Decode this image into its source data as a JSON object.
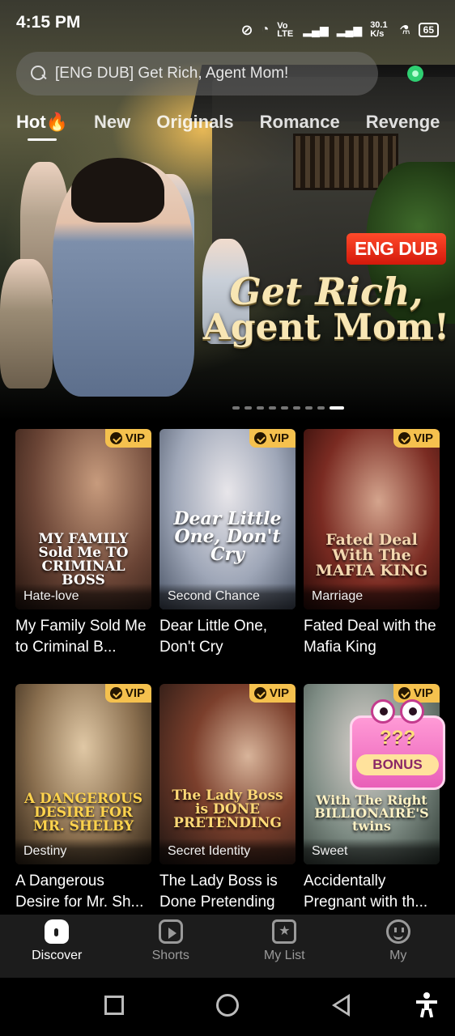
{
  "status_bar": {
    "time": "4:15 PM",
    "network": "Vo LTE",
    "speed": "30.1 K/s",
    "battery": "65"
  },
  "search": {
    "placeholder": "[ENG DUB] Get Rich, Agent Mom!"
  },
  "tabs": [
    {
      "label": "Hot🔥",
      "active": true
    },
    {
      "label": "New"
    },
    {
      "label": "Originals"
    },
    {
      "label": "Romance"
    },
    {
      "label": "Revenge"
    }
  ],
  "hero": {
    "badge": "ENG DUB",
    "title_line1": "Get Rich,",
    "title_line2": "Agent Mom!",
    "slide_count": 9,
    "active_slide": 9
  },
  "vip_label": "VIP",
  "cards": [
    {
      "tag": "Hate-love",
      "title": "My Family Sold Me to Criminal B...",
      "poster_text": "MY FAMILY Sold Me TO CRIMINAL BOSS"
    },
    {
      "tag": "Second Chance",
      "title": "Dear Little One, Don't Cry",
      "poster_text": "Dear Little One, Don't Cry"
    },
    {
      "tag": "Marriage",
      "title": "Fated Deal with the Mafia King",
      "poster_text": "Fated Deal With The MAFIA KING"
    },
    {
      "tag": "Destiny",
      "title": "A Dangerous Desire for Mr. Sh...",
      "poster_text": "A DANGEROUS DESIRE FOR MR. SHELBY"
    },
    {
      "tag": "Secret Identity",
      "title": "The Lady Boss is Done Pretending",
      "poster_text": "The Lady Boss is DONE PRETENDING"
    },
    {
      "tag": "Sweet",
      "title": "Accidentally Pregnant with th...",
      "poster_text": "With The Right BILLIONAIRE'S twins"
    }
  ],
  "bonus": {
    "marks": "???",
    "label": "BONUS"
  },
  "bottom_nav": [
    {
      "label": "Discover",
      "icon": "home-icon",
      "active": true
    },
    {
      "label": "Shorts",
      "icon": "play-icon"
    },
    {
      "label": "My List",
      "icon": "star-list-icon"
    },
    {
      "label": "My",
      "icon": "profile-icon"
    }
  ]
}
